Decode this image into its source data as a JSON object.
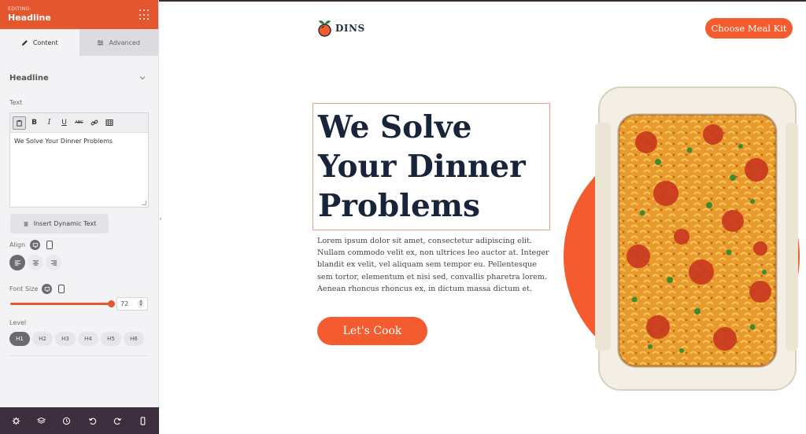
{
  "panel": {
    "kicker": "EDITING:",
    "title": "Headline",
    "tabs": [
      {
        "label": "Content",
        "icon": "pencil-icon",
        "active": true
      },
      {
        "label": "Advanced",
        "icon": "sliders-icon",
        "active": false
      }
    ],
    "section_title": "Headline",
    "text_label": "Text",
    "text_value": "We Solve Your Dinner Problems",
    "toolbar_items": [
      "paste-icon",
      "B",
      "I",
      "U",
      "ABC",
      "link-icon",
      "table-icon"
    ],
    "dynamic_button": "Insert Dynamic Text",
    "align_label": "Align",
    "font_size_label": "Font Size",
    "font_size_value": "72",
    "font_size_slider_fraction": 1.0,
    "level_label": "Level",
    "levels": [
      "H1",
      "H2",
      "H3",
      "H4",
      "H5",
      "H6"
    ],
    "active_level": "H1",
    "accent": "#e4572e",
    "footer_icons": [
      "settings-icon",
      "layers-icon",
      "history-icon",
      "undo-icon",
      "redo-icon",
      "mobile-preview-icon"
    ]
  },
  "page": {
    "brand": "DINS",
    "top_cta": "Choose Meal Kit",
    "headline": "We Solve Your Dinner Problems",
    "paragraph": "Lorem ipsum dolor sit amet, consectetur adipiscing elit. Nullam commodo velit ex, non ultrices leo auctor at. Integer blandit ex velit, vel aliquam sem tempor eu. Pellentesque sem tortor, elementum et nisi sed, convallis pharetra lorem. Aenean rhoncus rhoncus ex, in dictum massa dictum et.",
    "main_cta": "Let's Cook",
    "accent": "#f45b2f",
    "headline_color": "#17243a"
  }
}
